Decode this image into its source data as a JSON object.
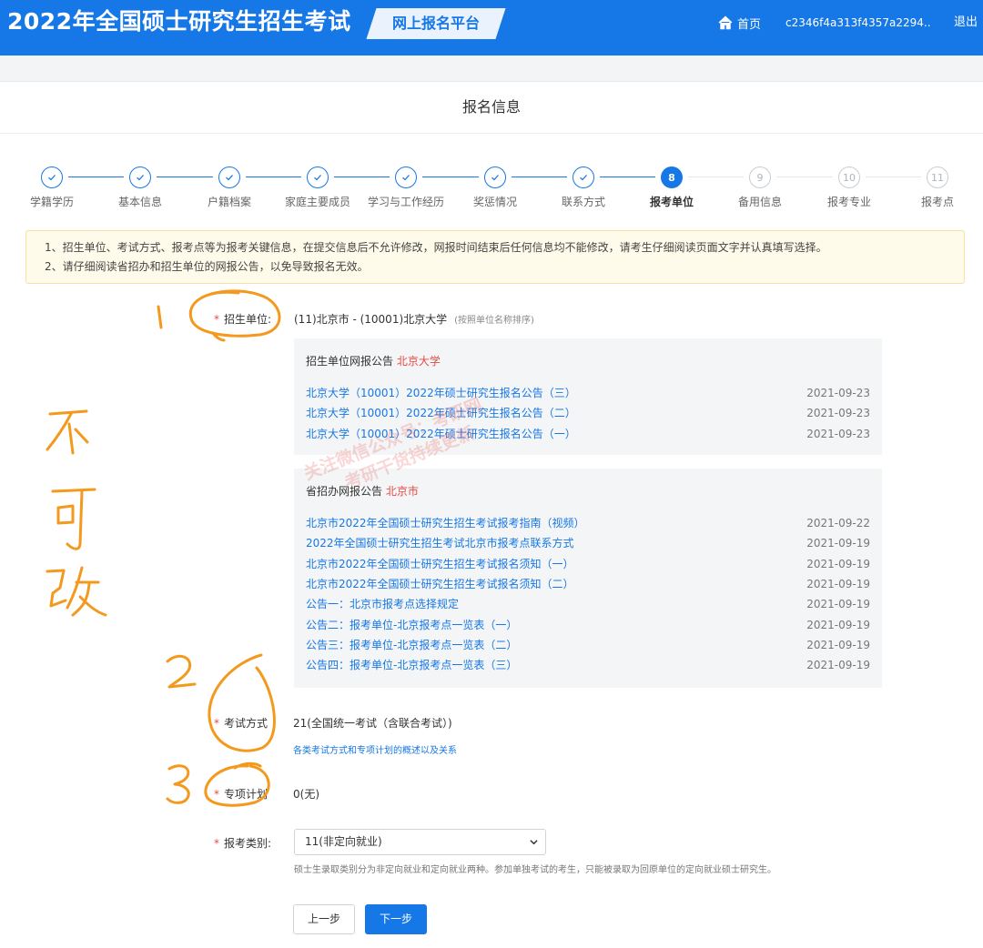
{
  "header": {
    "title": "2022年全国硕士研究生招生考试",
    "platform": "网上报名平台",
    "home": "首页",
    "user_id": "c2346f4a313f4357a2294...",
    "logout": "退出"
  },
  "page_title": "报名信息",
  "steps": [
    {
      "label": "学籍学历",
      "state": "done",
      "num": ""
    },
    {
      "label": "基本信息",
      "state": "done",
      "num": ""
    },
    {
      "label": "户籍档案",
      "state": "done",
      "num": ""
    },
    {
      "label": "家庭主要成员",
      "state": "done",
      "num": ""
    },
    {
      "label": "学习与工作经历",
      "state": "done",
      "num": ""
    },
    {
      "label": "奖惩情况",
      "state": "done",
      "num": ""
    },
    {
      "label": "联系方式",
      "state": "done",
      "num": ""
    },
    {
      "label": "报考单位",
      "state": "active",
      "num": "8"
    },
    {
      "label": "备用信息",
      "state": "todo",
      "num": "9"
    },
    {
      "label": "报考专业",
      "state": "todo",
      "num": "10"
    },
    {
      "label": "报考点",
      "state": "todo",
      "num": "11"
    }
  ],
  "notice": {
    "line1": "1、招生单位、考试方式、报考点等为报考关键信息，在提交信息后不允许修改，网报时间结束后任何信息均不能修改，请考生仔细阅读页面文字并认真填写选择。",
    "line2": "2、请仔细阅读省招办和招生单位的网报公告，以免导致报名无效。"
  },
  "form": {
    "unit_label": "招生单位:",
    "unit_value": "(11)北京市 - (10001)北京大学",
    "unit_hint": "(按照单位名称排序)",
    "unit_panel": {
      "head": "招生单位网报公告",
      "head_red": "北京大学",
      "items": [
        {
          "title": "北京大学（10001）2022年硕士研究生报名公告（三）",
          "date": "2021-09-23"
        },
        {
          "title": "北京大学（10001）2022年硕士研究生报名公告（二）",
          "date": "2021-09-23"
        },
        {
          "title": "北京大学（10001）2022年硕士研究生报名公告（一）",
          "date": "2021-09-23"
        }
      ]
    },
    "prov_panel": {
      "head": "省招办网报公告",
      "head_red": "北京市",
      "items": [
        {
          "title": "北京市2022年全国硕士研究生招生考试报考指南（视频）",
          "date": "2021-09-22"
        },
        {
          "title": "2022年全国硕士研究生招生考试北京市报考点联系方式",
          "date": "2021-09-19"
        },
        {
          "title": "北京市2022年全国硕士研究生招生考试报名须知（一）",
          "date": "2021-09-19"
        },
        {
          "title": "北京市2022年全国硕士研究生招生考试报名须知（二）",
          "date": "2021-09-19"
        },
        {
          "title": "公告一：北京市报考点选择规定",
          "date": "2021-09-19"
        },
        {
          "title": "公告二：报考单位-北京报考点一览表（一）",
          "date": "2021-09-19"
        },
        {
          "title": "公告三：报考单位-北京报考点一览表（二）",
          "date": "2021-09-19"
        },
        {
          "title": "公告四：报考单位-北京报考点一览表（三）",
          "date": "2021-09-19"
        }
      ]
    },
    "exam_label": "考试方式",
    "exam_value": "21(全国统一考试（含联合考试）)",
    "exam_link": "各类考试方式和专项计划的概述以及关系",
    "plan_label": "专项计划",
    "plan_value": "0(无)",
    "category_label": "报考类别:",
    "category_value": "11(非定向就业)",
    "category_hint": "硕士生录取类别分为非定向就业和定向就业两种。参加单独考试的考生，只能被录取为回原单位的定向就业硕士研究生。",
    "prev": "上一步",
    "next": "下一步"
  },
  "annotations": {
    "num1": "1",
    "num2": "2",
    "num3": "3",
    "side": [
      "不",
      "可",
      "改"
    ]
  },
  "watermark": {
    "line1": "关注微信公众号：考研网",
    "line2": "考研干货持续更新"
  },
  "colors": {
    "primary": "#1677e6",
    "required": "#e84a43",
    "annotation": "#f39a1e"
  }
}
